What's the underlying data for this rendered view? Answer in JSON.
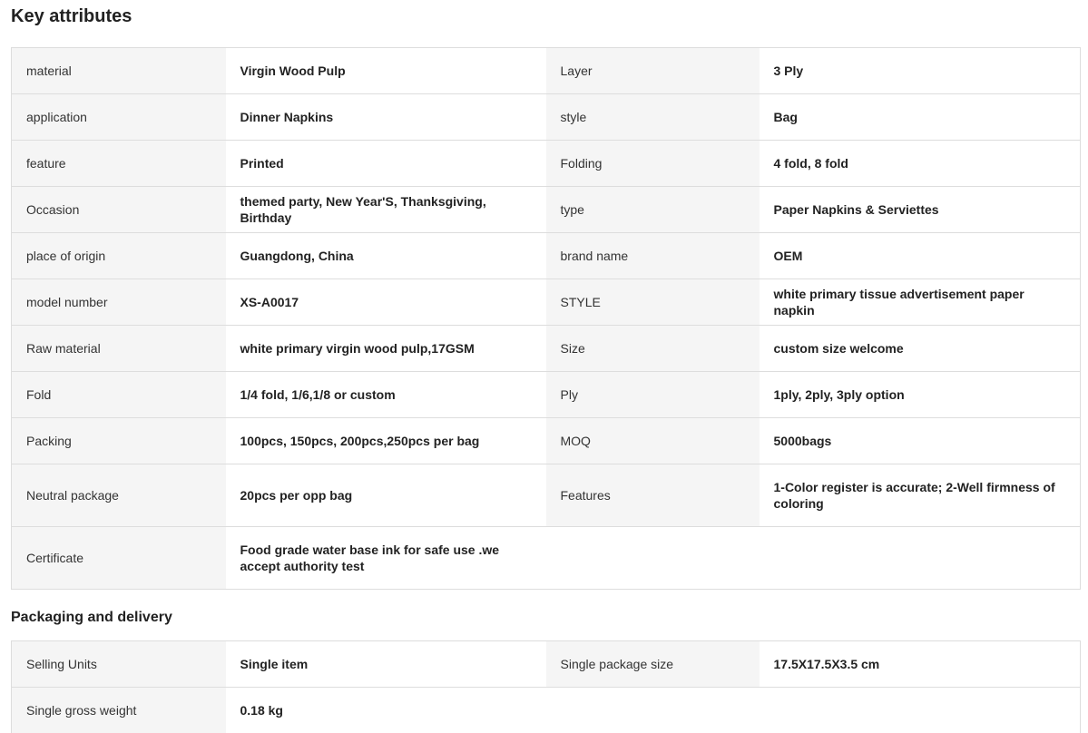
{
  "key_attributes": {
    "title": "Key attributes",
    "rows": [
      [
        "material",
        "Virgin Wood Pulp",
        "Layer",
        "3 Ply"
      ],
      [
        "application",
        "Dinner Napkins",
        "style",
        "Bag"
      ],
      [
        "feature",
        "Printed",
        "Folding",
        "4 fold, 8 fold"
      ],
      [
        "Occasion",
        "themed party, New Year'S, Thanksgiving, Birthday",
        "type",
        "Paper Napkins & Serviettes"
      ],
      [
        "place of origin",
        "Guangdong, China",
        "brand name",
        "OEM"
      ],
      [
        "model number",
        "XS-A0017",
        "STYLE",
        "white primary tissue advertisement paper napkin"
      ],
      [
        "Raw material",
        "white primary virgin wood pulp,17GSM",
        "Size",
        "custom size welcome"
      ],
      [
        "Fold",
        "1/4 fold, 1/6,1/8 or custom",
        "Ply",
        "1ply, 2ply, 3ply option"
      ],
      [
        "Packing",
        "100pcs, 150pcs, 200pcs,250pcs per bag",
        "MOQ",
        "5000bags"
      ],
      [
        "Neutral package",
        "20pcs per opp bag",
        "Features",
        "1-Color register is accurate; 2-Well firmness of coloring"
      ],
      [
        "Certificate",
        "Food grade water base ink for safe use .we accept authority test",
        "",
        ""
      ]
    ]
  },
  "packaging": {
    "title": "Packaging and delivery",
    "rows": [
      [
        "Selling Units",
        "Single item",
        "Single package size",
        "17.5X17.5X3.5 cm"
      ],
      [
        "Single gross weight",
        "0.18 kg",
        "",
        ""
      ]
    ]
  }
}
